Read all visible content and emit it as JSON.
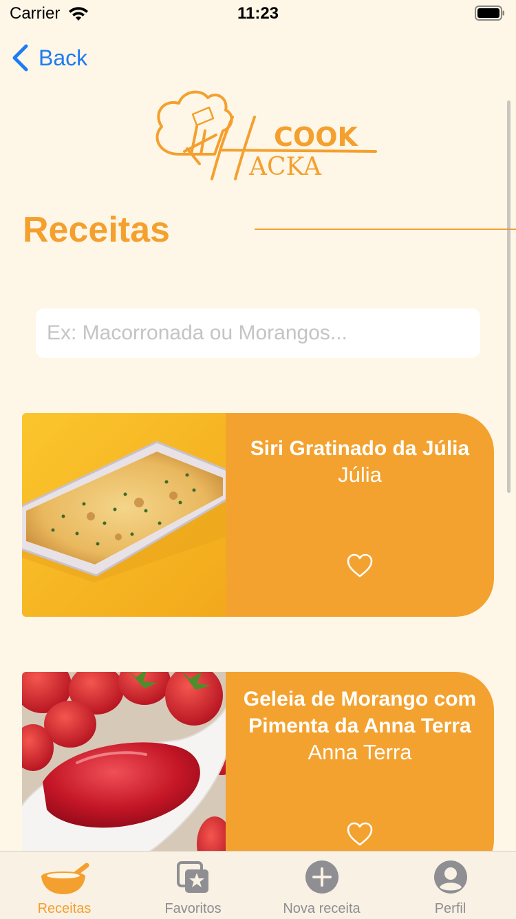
{
  "status": {
    "carrier": "Carrier",
    "time": "11:23"
  },
  "nav": {
    "back_label": "Back"
  },
  "logo": {
    "word1": "COOK",
    "word2": "ACKA",
    "letter": "H"
  },
  "page": {
    "title": "Receitas"
  },
  "search": {
    "placeholder": "Ex: Macorronada ou Morangos...",
    "value": ""
  },
  "recipes": [
    {
      "title": "Siri Gratinado da Júlia",
      "author": "Júlia",
      "favorite": false
    },
    {
      "title": "Geleia de Morango com Pimenta da Anna Terra",
      "author": "Anna Terra",
      "favorite": false
    }
  ],
  "tabs": [
    {
      "label": "Receitas",
      "icon": "bowl-icon",
      "active": true
    },
    {
      "label": "Favoritos",
      "icon": "favorites-icon",
      "active": false
    },
    {
      "label": "Nova receita",
      "icon": "plus-circle-icon",
      "active": false
    },
    {
      "label": "Perfil",
      "icon": "person-circle-icon",
      "active": false
    }
  ],
  "colors": {
    "accent": "#F4A02E",
    "card": "#F4A22F",
    "background": "#FEF6E7",
    "link": "#1E7CF2",
    "inactive": "#8E8E93"
  }
}
